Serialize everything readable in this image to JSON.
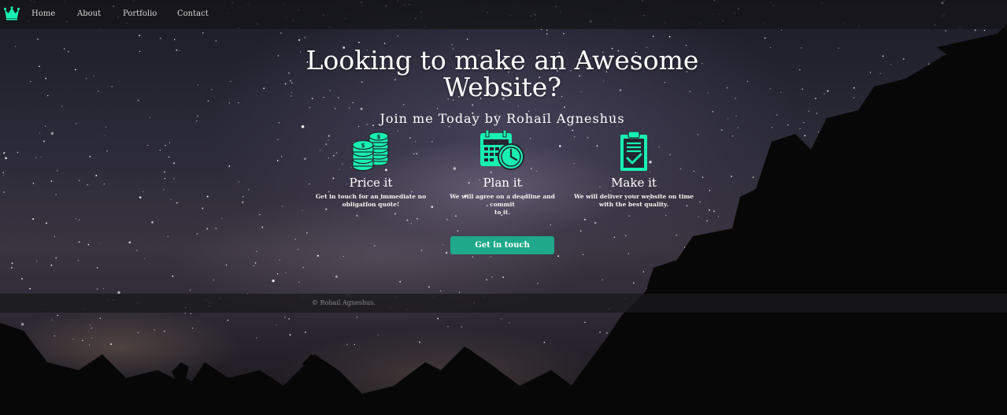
{
  "colors": {
    "accent": "#17f0b0",
    "button": "#1fa98a"
  },
  "navbar": {
    "logo_icon": "crown-icon",
    "links": [
      "Home",
      "About",
      "Portfolio",
      "Contact"
    ]
  },
  "hero": {
    "title_line1": "Looking to make an Awesome",
    "title_line2": "Website?",
    "subtitle": "Join me Today by Rohail Agneshus"
  },
  "features": [
    {
      "icon": "coins-icon",
      "title": "Price it",
      "desc_line1": "Get in touch for an immediate no",
      "desc_line2": "obligation quote!"
    },
    {
      "icon": "calendar-clock-icon",
      "title": "Plan it",
      "desc_line1": "We will agree on a deadline and commit",
      "desc_line2": "to it."
    },
    {
      "icon": "clipboard-check-icon",
      "title": "Make it",
      "desc_line1": "We will deliver your website on time",
      "desc_line2": "with the best quality."
    }
  ],
  "cta": {
    "label": "Get in touch"
  },
  "footer": {
    "text": "© Rohail Agneshus."
  }
}
